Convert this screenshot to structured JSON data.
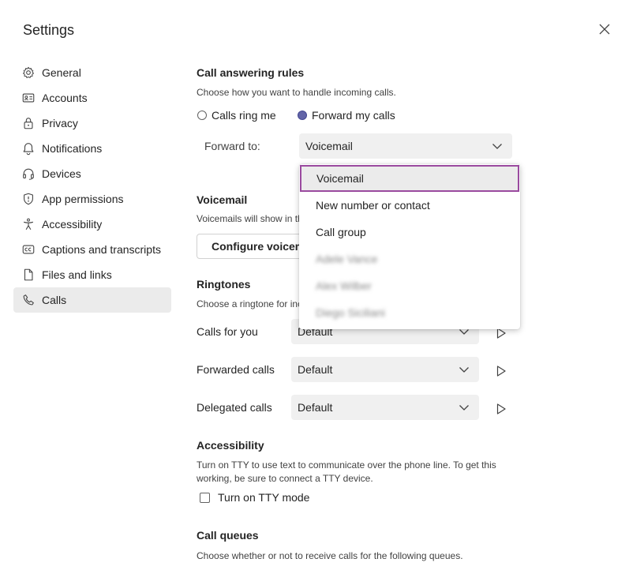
{
  "header": {
    "title": "Settings"
  },
  "nav": [
    {
      "label": "General",
      "icon": "gear-icon"
    },
    {
      "label": "Accounts",
      "icon": "id-card-icon"
    },
    {
      "label": "Privacy",
      "icon": "lock-icon"
    },
    {
      "label": "Notifications",
      "icon": "bell-icon"
    },
    {
      "label": "Devices",
      "icon": "headset-icon"
    },
    {
      "label": "App permissions",
      "icon": "shield-icon"
    },
    {
      "label": "Accessibility",
      "icon": "accessibility-icon"
    },
    {
      "label": "Captions and transcripts",
      "icon": "cc-icon"
    },
    {
      "label": "Files and links",
      "icon": "file-icon"
    },
    {
      "label": "Calls",
      "icon": "phone-icon",
      "active": true
    }
  ],
  "call_answering": {
    "heading": "Call answering rules",
    "description": "Choose how you want to handle incoming calls.",
    "option_ring": "Calls ring me",
    "option_forward": "Forward my calls",
    "selected": "Forward my calls",
    "forward_label": "Forward to:",
    "forward_value": "Voicemail"
  },
  "voicemail": {
    "heading": "Voicemail",
    "description": "Voicemails will show in th",
    "button": "Configure voicem"
  },
  "ringtones": {
    "heading": "Ringtones",
    "description": "Choose a ringtone for inc",
    "rows": [
      {
        "label": "Calls for you",
        "value": "Default"
      },
      {
        "label": "Forwarded calls",
        "value": "Default"
      },
      {
        "label": "Delegated calls",
        "value": "Default"
      }
    ]
  },
  "accessibility": {
    "heading": "Accessibility",
    "description_line1": "Turn on TTY to use text to communicate over the phone line. To get this",
    "description_line2": "working, be sure to connect a TTY device.",
    "checkbox_label": "Turn on TTY mode",
    "checked": false
  },
  "call_queues": {
    "heading": "Call queues",
    "description": "Choose whether or not to receive calls for the following queues."
  },
  "dropdown": {
    "options": [
      {
        "label": "Voicemail",
        "selected": true
      },
      {
        "label": "New number or contact"
      },
      {
        "label": "Call group"
      },
      {
        "label": "Adele Vance",
        "blurred": true
      },
      {
        "label": "Alex Wilber",
        "blurred": true
      },
      {
        "label": "Diego Siciliani",
        "blurred": true
      }
    ]
  },
  "colors": {
    "accent": "#6264a7",
    "focus_border": "#9a4a9f",
    "active_nav": "#ebebeb",
    "field_bg": "#f0f0f0"
  }
}
